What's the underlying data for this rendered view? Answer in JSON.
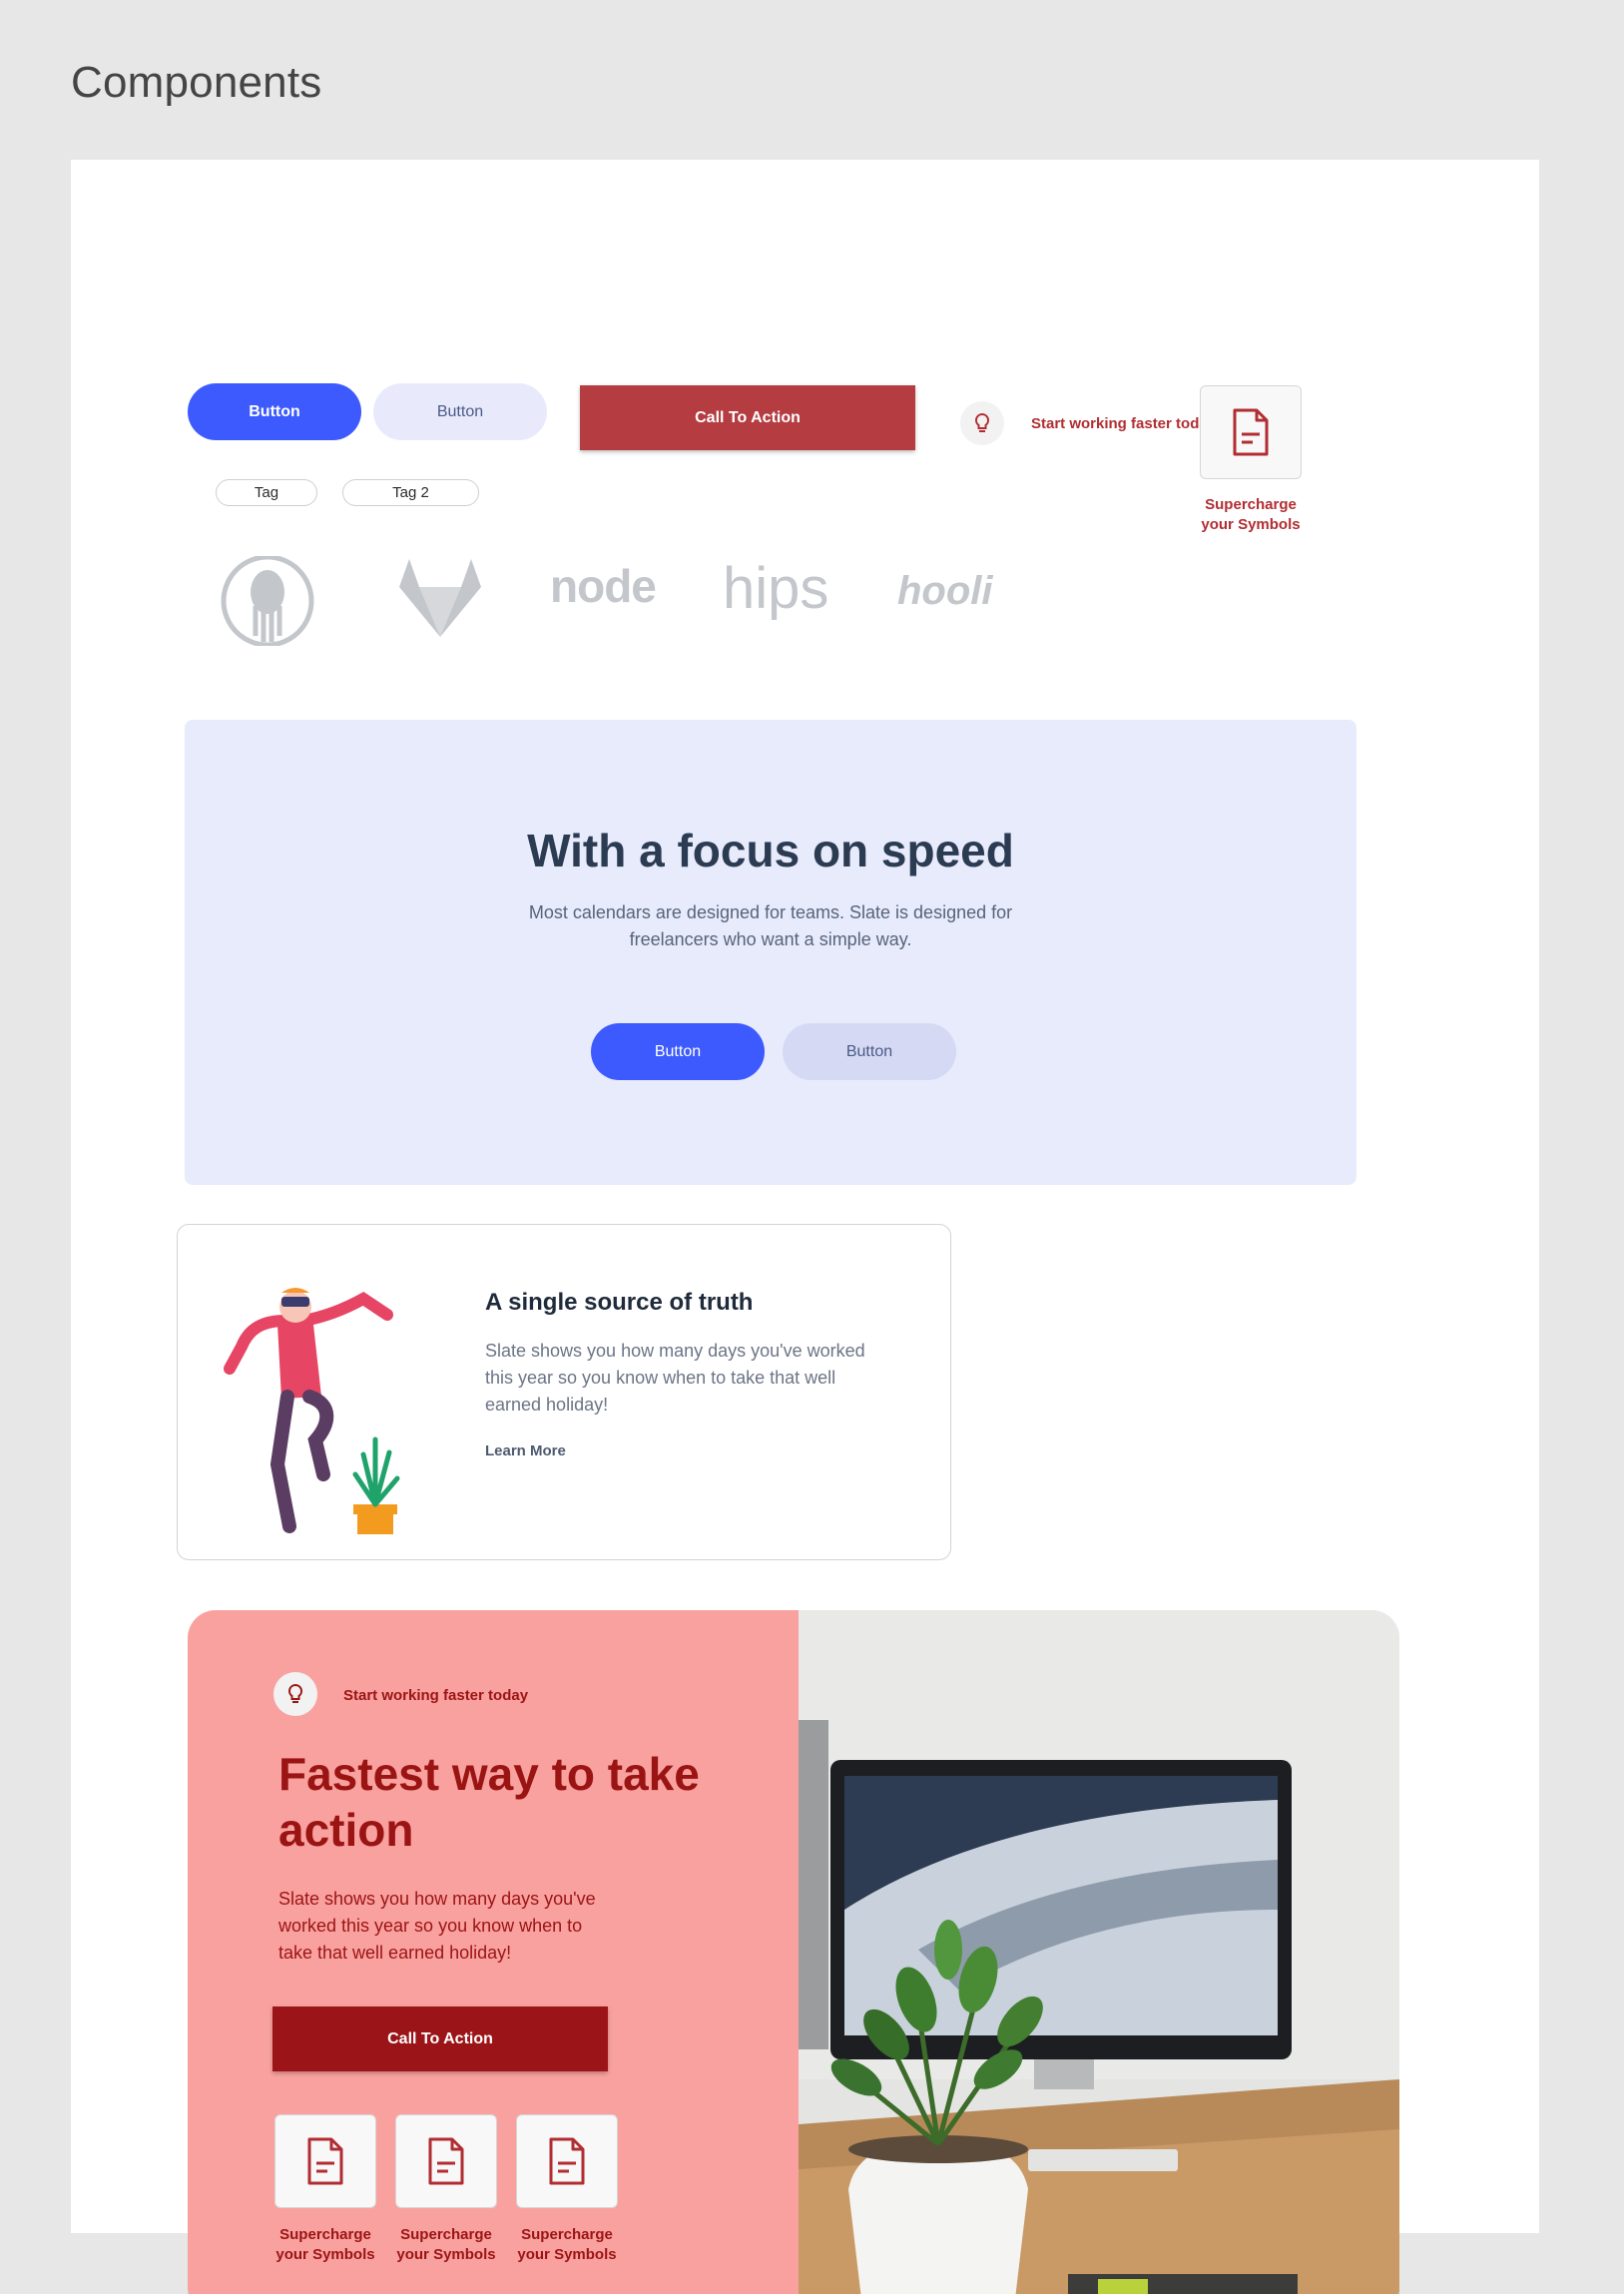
{
  "page": {
    "title": "Components"
  },
  "buttons": {
    "primary": "Button",
    "secondary": "Button",
    "cta": "Call To Action"
  },
  "hint": {
    "text": "Start working faster today"
  },
  "symbol": {
    "caption_line1": "Supercharge",
    "caption_line2": "your Symbols"
  },
  "tags": [
    "Tag",
    "Tag 2"
  ],
  "logos": [
    "gitkraken",
    "gitlab",
    "node",
    "hips",
    "hooli"
  ],
  "hero": {
    "title": "With a focus on speed",
    "subtitle": "Most calendars are designed for teams. Slate is designed for freelancers who want a simple way.",
    "primary_button": "Button",
    "secondary_button": "Button"
  },
  "feature": {
    "title": "A single source of truth",
    "body": "Slate shows you how many days you've worked this year so you know when to take that well earned holiday!",
    "link": "Learn More"
  },
  "promo": {
    "hint": "Start working faster today",
    "title": "Fastest way to take action",
    "body": "Slate shows you how many days you've worked this year so you know when to take that well earned holiday!",
    "cta": "Call To Action",
    "symbols": [
      {
        "line1": "Supercharge",
        "line2": "your Symbols"
      },
      {
        "line1": "Supercharge",
        "line2": "your Symbols"
      },
      {
        "line1": "Supercharge",
        "line2": "your Symbols"
      }
    ]
  },
  "colors": {
    "primary": "#3d5afe",
    "cta_red": "#b53c40",
    "dark_red": "#9b1417",
    "promo_bg": "#f9a19f",
    "hero_bg": "#e8ebfc"
  }
}
